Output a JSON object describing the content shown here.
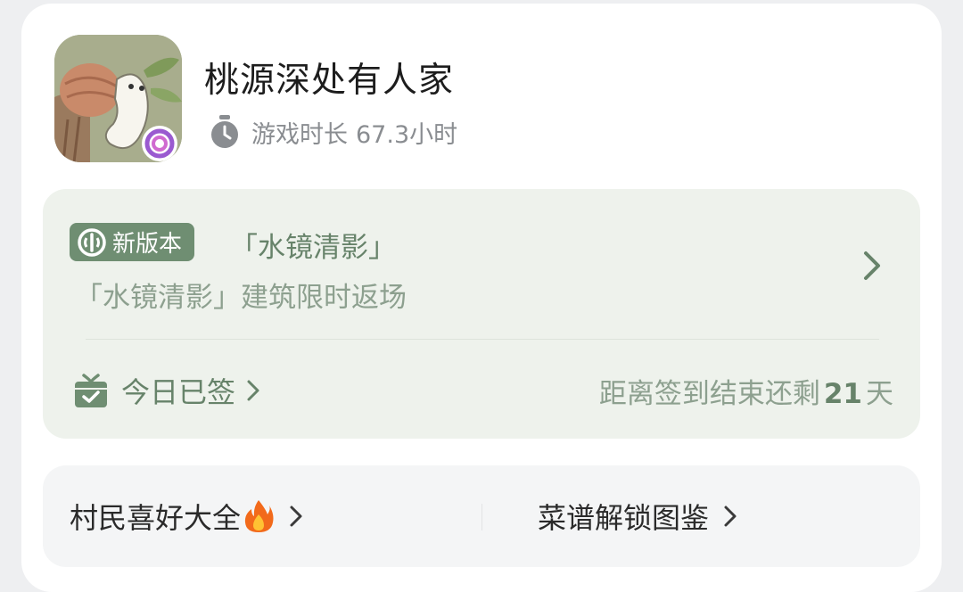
{
  "game": {
    "title": "桃源深处有人家",
    "playtime_label": "游戏时长",
    "playtime_value": "67.3小时",
    "icon": "game-app-icon"
  },
  "update": {
    "badge_label": "新版本",
    "title": "「水镜清影」",
    "description": "「水镜清影」建筑限时返场"
  },
  "checkin": {
    "label": "今日已签",
    "countdown_prefix": "距离签到结束还剩",
    "days_left": "21",
    "days_unit": "天"
  },
  "links": {
    "left_label": "村民喜好大全",
    "right_label": "菜谱解锁图鉴"
  },
  "colors": {
    "card_bg": "#ffffff",
    "update_panel_bg": "#eef2ec",
    "accent_green": "#6f8e72",
    "muted_green": "#8da08f",
    "links_panel_bg": "#f4f5f6"
  }
}
